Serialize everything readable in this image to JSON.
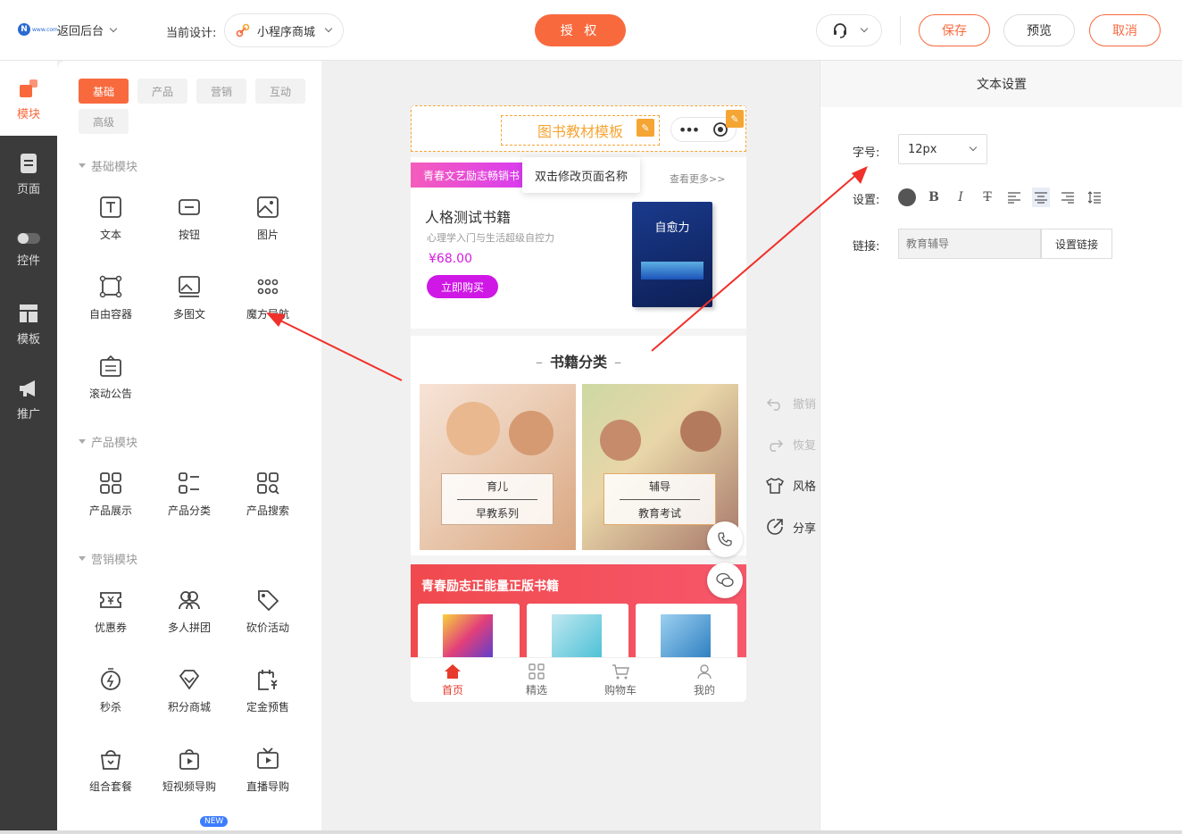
{
  "header": {
    "logo_text": "N",
    "logo_sub": "www.com",
    "back_label": "返回后台",
    "current_design_label": "当前设计:",
    "current_design_value": "小程序商城",
    "auth_label": "授 权",
    "save_label": "保存",
    "preview_label": "预览",
    "cancel_label": "取消"
  },
  "rail": [
    {
      "label": "模块",
      "icon": "module-icon",
      "active": true
    },
    {
      "label": "页面",
      "icon": "page-icon"
    },
    {
      "label": "控件",
      "icon": "toggle-icon"
    },
    {
      "label": "模板",
      "icon": "template-icon"
    },
    {
      "label": "推广",
      "icon": "megaphone-icon"
    }
  ],
  "panel": {
    "tabs": [
      "基础",
      "产品",
      "营销",
      "互动",
      "高级"
    ],
    "sections": {
      "basic": {
        "title": "基础模块",
        "items": [
          "文本",
          "按钮",
          "图片",
          "自由容器",
          "多图文",
          "魔方导航",
          "滚动公告"
        ]
      },
      "product": {
        "title": "产品模块",
        "items": [
          "产品展示",
          "产品分类",
          "产品搜索"
        ]
      },
      "marketing": {
        "title": "营销模块",
        "items": [
          "优惠券",
          "多人拼团",
          "砍价活动",
          "秒杀",
          "积分商城",
          "定金预售",
          "组合套餐",
          "短视频导购",
          "直播导购"
        ]
      }
    },
    "new_badge": "NEW"
  },
  "phone": {
    "page_title": "图书教材模板",
    "tooltip": "双击修改页面名称",
    "product_card": {
      "tag": "青春文艺励志畅销书",
      "more": "查看更多>>",
      "name": "人格测试书籍",
      "subtitle": "心理学入门与生活超级自控力",
      "price": "¥68.00",
      "buy_label": "立即购买",
      "book_cover_title": "自愈力"
    },
    "category": {
      "title": "书籍分类",
      "items": [
        {
          "name": "育儿",
          "sub": "早教系列"
        },
        {
          "name": "辅导",
          "sub": "教育考试"
        }
      ]
    },
    "promo_title": "青春励志正能量正版书籍",
    "tabbar": [
      "首页",
      "精选",
      "购物车",
      "我的"
    ]
  },
  "side_actions": [
    "撤销",
    "恢复",
    "风格",
    "分享"
  ],
  "right_panel": {
    "title": "文本设置",
    "font_size_label": "字号:",
    "font_size_value": "12px",
    "settings_label": "设置:",
    "link_label": "链接:",
    "link_placeholder": "教育辅导",
    "link_button": "设置链接"
  },
  "colors": {
    "accent": "#f86a3e",
    "title_orange": "#f5a533",
    "magenta": "#cf18e6",
    "rail_bg": "#3b3b3b"
  }
}
